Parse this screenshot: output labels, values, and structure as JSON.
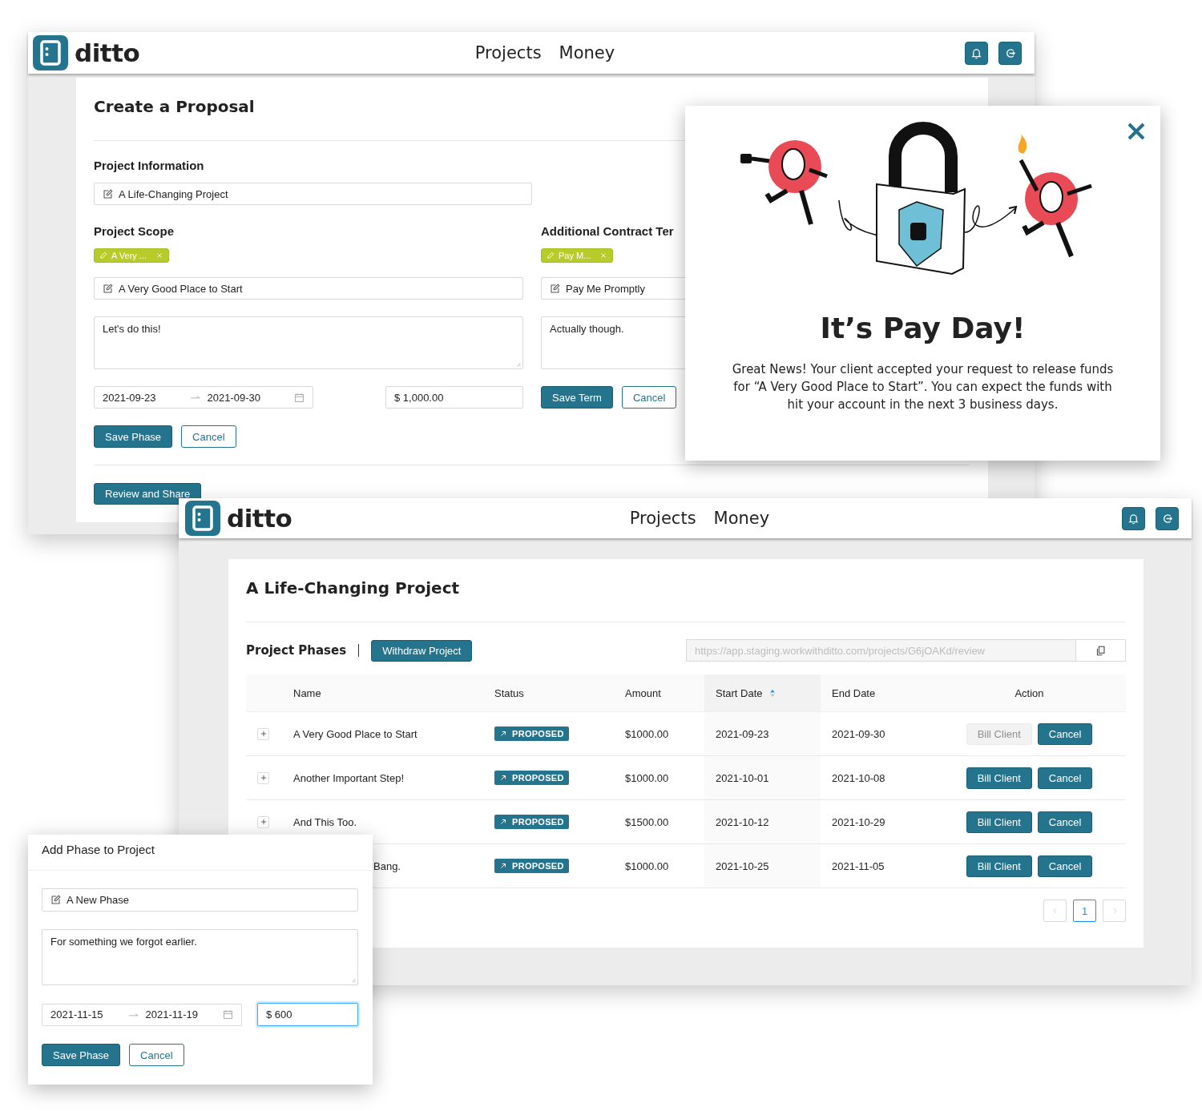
{
  "proposal_window": {
    "app_bar": {
      "logo": "ditto",
      "nav": [
        "Projects",
        "Money"
      ]
    },
    "title": "Create a Proposal",
    "project_information": {
      "heading": "Project Information",
      "name": "A Life-Changing Project"
    },
    "project_scope": {
      "heading": "Project Scope",
      "tags": [
        {
          "label": "A Very ..."
        }
      ],
      "phase_name": "A Very Good Place to Start",
      "description": "Let's do this!",
      "start_date": "2021-09-23",
      "end_date": "2021-09-30",
      "amount": "$ 1,000.00",
      "buttons": [
        {
          "label": "Save Phase",
          "kind": "primary"
        },
        {
          "label": "Cancel",
          "kind": "secondary"
        }
      ]
    },
    "contract_terms": {
      "heading": "Additional Contract Ter",
      "tags": [
        {
          "label": "Pay M..."
        }
      ],
      "term_name": "Pay Me Promptly",
      "description": "Actually though.",
      "buttons": [
        {
          "label": "Save Term",
          "kind": "primary"
        },
        {
          "label": "Cancel",
          "kind": "secondary"
        }
      ]
    },
    "review_button": "Review and Share"
  },
  "pay_day_modal": {
    "title": "It’s Pay Day!",
    "message": "Great News! Your client accepted your request to release funds for “A Very Good Place to Start”. You can expect the funds with hit your account in the next 3 business days."
  },
  "project_window": {
    "app_bar": {
      "logo": "ditto",
      "nav": [
        "Projects",
        "Money"
      ]
    },
    "title": "A Life-Changing Project",
    "phases_heading": "Project Phases",
    "withdraw_button": "Withdraw Project",
    "share_link": "https://app.staging.workwithditto.com/projects/G6jOAKd/review",
    "table": {
      "columns": [
        {
          "label": "Name",
          "sorted": false
        },
        {
          "label": "Status",
          "sorted": false
        },
        {
          "label": "Amount",
          "sorted": false
        },
        {
          "label": "Start Date",
          "sorted": true
        },
        {
          "label": "End Date",
          "sorted": false
        },
        {
          "label": "Action",
          "sorted": false
        }
      ],
      "rows": [
        {
          "kind": "full",
          "name": "A Very Good Place to Start",
          "status": "PROPOSED",
          "amount": "$1000.00",
          "start_date": "2021-09-23",
          "end_date": "2021-09-30",
          "actions": [
            {
              "label": "Bill Client",
              "disabled": true
            },
            {
              "label": "Cancel",
              "disabled": false
            }
          ]
        },
        {
          "kind": "full",
          "name": "Another Important Step!",
          "status": "PROPOSED",
          "amount": "$1000.00",
          "start_date": "2021-10-01",
          "end_date": "2021-10-08",
          "actions": [
            {
              "label": "Bill Client",
              "disabled": false
            },
            {
              "label": "Cancel",
              "disabled": false
            }
          ]
        },
        {
          "kind": "full",
          "name": "And This Too.",
          "status": "PROPOSED",
          "amount": "$1500.00",
          "start_date": "2021-10-12",
          "end_date": "2021-10-29",
          "actions": [
            {
              "label": "Bill Client",
              "disabled": false
            },
            {
              "label": "Cancel",
              "disabled": false
            }
          ]
        },
        {
          "kind": "partial",
          "name": "Bang.",
          "status": "PROPOSED",
          "amount": "$1000.00",
          "start_date": "2021-10-25",
          "end_date": "2021-11-05",
          "actions": [
            {
              "label": "Bill Client",
              "disabled": false
            },
            {
              "label": "Cancel",
              "disabled": false
            }
          ]
        }
      ]
    },
    "pagination": {
      "previous_disabled": true,
      "next_disabled": true,
      "pages": [
        {
          "label": "1",
          "selected": true
        }
      ]
    }
  },
  "add_phase_dialog": {
    "title": "Add Phase to Project",
    "phase_name": "A New Phase",
    "description": "For something we forgot earlier.",
    "start_date": "2021-11-15",
    "end_date": "2021-11-19",
    "amount": {
      "value": "$ 600",
      "focused": true
    },
    "buttons": [
      {
        "label": "Save Phase",
        "kind": "primary"
      },
      {
        "label": "Cancel",
        "kind": "secondary"
      }
    ]
  }
}
